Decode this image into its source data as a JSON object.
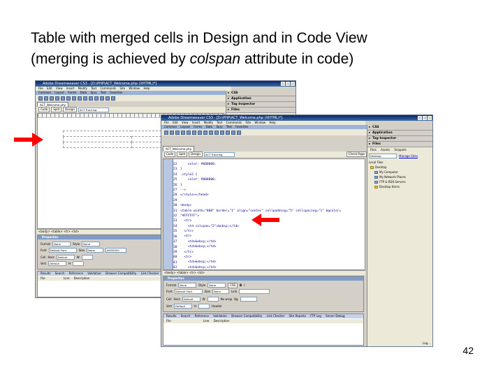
{
  "slide": {
    "title_line1": "Table with merged cells in Design and in Code View",
    "title_line2_before": "(merging is achieved by ",
    "title_line2_em": "colspan",
    "title_line2_after": " attribute in code)",
    "page_number": "42"
  },
  "design_window": {
    "title": "Adobe Dreamweaver CS3 - [D:\\PHP\\ACT_Welcome.php (XHTML)*]",
    "menu": [
      "File",
      "Edit",
      "View",
      "Insert",
      "Modify",
      "Text",
      "Commands",
      "Site",
      "Window",
      "Help"
    ],
    "insert_tabs": [
      "Common",
      "Layout",
      "Forms",
      "Data",
      "Spry",
      "Text",
      "Favorites"
    ],
    "doc_tab": "ACT_Welcome.php",
    "view_buttons": [
      "Code",
      "Split",
      "Design"
    ],
    "title_field": "ACT Tracking",
    "tag_selector": "<body> <table> <tr> <td>",
    "properties_title": "Properties",
    "props": {
      "format_label": "Format",
      "format_value": "None",
      "style_label": "Style",
      "style_value": "None",
      "font_label": "Font",
      "font_value": "Default Font",
      "size_label": "Size",
      "size_value": "None",
      "cell_label": "Cell",
      "horz_label": "Horz",
      "horz_value": "Default",
      "vert_label": "Vert",
      "vert_value": "Default",
      "w_label": "W",
      "h_label": "H",
      "bg_value": "#000000"
    },
    "results_tabs": [
      "Results",
      "Search",
      "Reference",
      "Validation",
      "Browser Compatibility",
      "Link Checker",
      "Site Reports"
    ],
    "results_cols": [
      "File",
      "Line",
      "Description"
    ],
    "panels": [
      "CSS",
      "Application",
      "Tag Inspector",
      "Files"
    ]
  },
  "code_window": {
    "title": "Adobe Dreamweaver CS3 - [D:\\PHP\\ACT_Welcome.php (XHTML)*]",
    "menu": [
      "File",
      "Edit",
      "View",
      "Insert",
      "Modify",
      "Text",
      "Commands",
      "Site",
      "Window",
      "Help"
    ],
    "insert_tabs": [
      "Common",
      "Layout",
      "Forms",
      "Data",
      "Spry",
      "Text",
      "Favorites"
    ],
    "doc_tab": "ACT_Welcome.php",
    "view_buttons": [
      "Code",
      "Split",
      "Design"
    ],
    "title_field": "ACT Tracking",
    "check_page": "Check Page",
    "line_numbers": [
      "22",
      "23",
      "24",
      "25",
      "26",
      "27",
      "28",
      "29",
      "30",
      "31",
      "32",
      "33",
      "34",
      "35",
      "36",
      "37",
      "38",
      "39",
      "40",
      "41",
      "42",
      "43",
      "44",
      "45"
    ],
    "code": [
      "    color: #000000;",
      "}",
      ".style2 {",
      "    color: #000000;",
      "}",
      "-->",
      "</style></head>",
      "",
      "<body>",
      "<table width=\"800\" border=\"1\" align=\"center\" cellpadding=\"5\" cellspacing=\"1\" bgcolor=",
      "\"#FFFFFF\">",
      "  <tr>",
      "    <td colspan=\"2\">&nbsp;</td>",
      "  </tr>",
      "  <tr>",
      "    <td>&nbsp;</td>",
      "    <td>&nbsp;</td>",
      "  </tr>",
      "  <tr>",
      "    <td>&nbsp;</td>",
      "    <td>&nbsp;</td>",
      "  </tr>",
      "</table>",
      ""
    ],
    "tag_selector": "<body> <table> <tr> <td>",
    "properties_title": "Properties",
    "props": {
      "format_label": "Format",
      "format_value": "None",
      "style_label": "Style",
      "style_value": "None",
      "css_label": "CSS",
      "font_label": "Font",
      "font_value": "Default Font",
      "size_label": "Size",
      "size_value": "None",
      "link_label": "Link",
      "cell_label": "Cell",
      "horz_label": "Horz",
      "horz_value": "Default",
      "vert_label": "Vert",
      "vert_value": "Default",
      "w_label": "W",
      "h_label": "H",
      "nowrap_label": "No wrap",
      "bg_label": "Bg",
      "header_label": "Header"
    },
    "results_tabs": [
      "Results",
      "Search",
      "Reference",
      "Validation",
      "Browser Compatibility",
      "Link Checker",
      "Site Reports",
      "FTP Log",
      "Server Debug"
    ],
    "results_cols": [
      "File",
      "Line",
      "Description"
    ],
    "panels": [
      "CSS",
      "Application",
      "Tag Inspector",
      "Files"
    ],
    "files_tabs": [
      "Files",
      "Assets",
      "Snippets"
    ],
    "site_select": "Desktop",
    "manage_sites": "Manage Sites",
    "local_files": "Local Files",
    "tree": [
      "Desktop",
      "My Computer",
      "My Network Places",
      "FTP & RDS Servers",
      "Desktop Items"
    ],
    "log": "Log..."
  },
  "colors": {
    "titlebar": "#0a246a",
    "arrow": "#ff0000",
    "code_tag": "#000088"
  }
}
